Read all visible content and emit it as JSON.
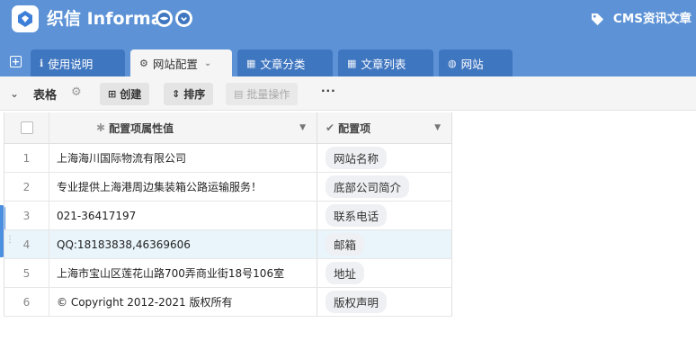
{
  "header": {
    "logo_text": "织信 Informat",
    "app_title": "CMS资讯文章",
    "colors": {
      "bar": "#5d93d6",
      "tab": "#3f76c0",
      "accent": "#4a8fe0"
    }
  },
  "tabs": [
    {
      "label": "使用说明",
      "icon": "info-icon"
    },
    {
      "label": "网站配置",
      "icon": "config-icon",
      "active": true
    },
    {
      "label": "文章分类",
      "icon": "table-icon"
    },
    {
      "label": "文章列表",
      "icon": "table-icon"
    },
    {
      "label": "网站",
      "icon": "globe-icon"
    }
  ],
  "toolbar": {
    "title": "表格",
    "create_label": "创建",
    "sort_label": "排序",
    "batch_label": "批量操作",
    "more_label": "···"
  },
  "grid": {
    "columns": [
      "配置项属性值",
      "配置项"
    ],
    "rows": [
      {
        "index": "1",
        "value": "上海海川国际物流有限公司",
        "item": "网站名称"
      },
      {
        "index": "2",
        "value": "专业提供上海港周边集装箱公路运输服务！",
        "item": "底部公司简介"
      },
      {
        "index": "3",
        "value": "021-36417197",
        "item": "联系电话"
      },
      {
        "index": "4",
        "value": "QQ:18183838,46369606",
        "item": "邮箱"
      },
      {
        "index": "5",
        "value": "上海市宝山区莲花山路700弄商业街18号106室",
        "item": "地址"
      },
      {
        "index": "6",
        "value": "© Copyright 2012-2021 版权所有",
        "item": "版权声明"
      }
    ]
  }
}
